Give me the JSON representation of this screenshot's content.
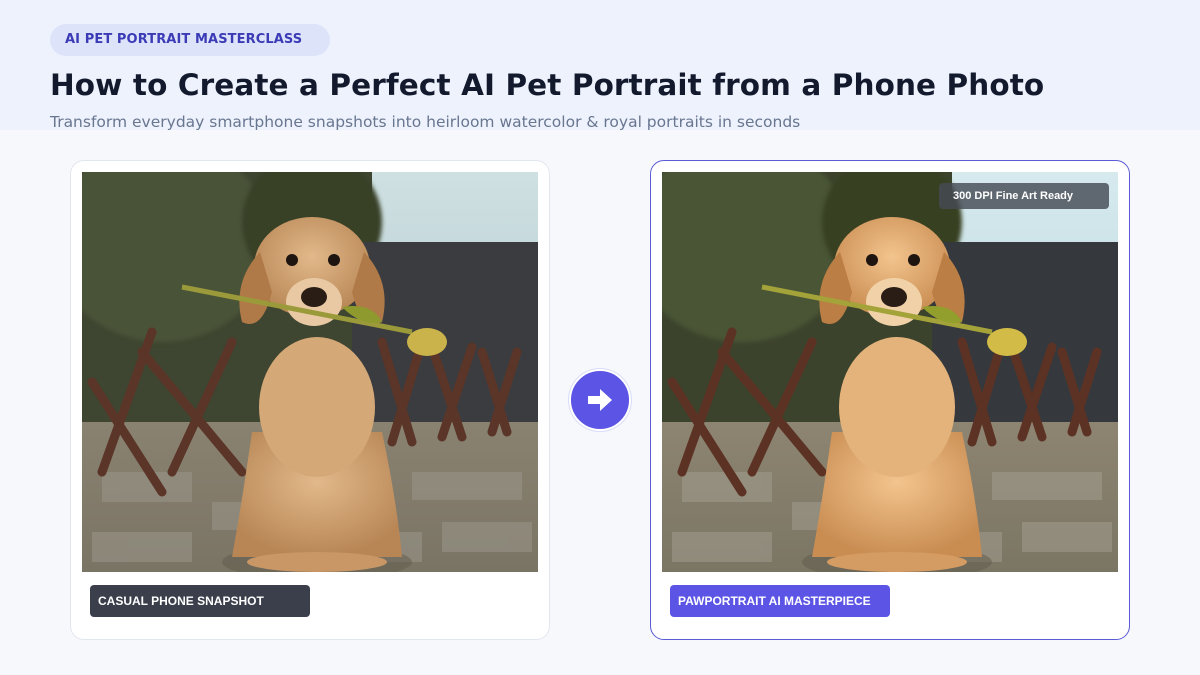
{
  "header": {
    "eyebrow": "AI PET PORTRAIT MASTERCLASS",
    "title": "How to Create a Perfect AI Pet Portrait from a Phone Photo",
    "subtitle": "Transform everyday smartphone snapshots into heirloom watercolor & royal portraits in seconds"
  },
  "before": {
    "label": "CASUAL PHONE SNAPSHOT",
    "image": "golden-retriever-puppy-holding-tulip-photo"
  },
  "after": {
    "label": "PAWPORTRAIT AI MASTERPIECE",
    "badge": "300 DPI Fine Art Ready",
    "image": "golden-retriever-puppy-holding-tulip-enhanced"
  },
  "transform_button": {
    "icon": "arrow-right-icon"
  },
  "colors": {
    "accent": "#5b54e4",
    "dark_label": "#3a3f4b",
    "title": "#141a2e",
    "subtitle": "#687690",
    "eyebrow_text": "#3b3bb6",
    "eyebrow_bg": "#dde4fa"
  }
}
